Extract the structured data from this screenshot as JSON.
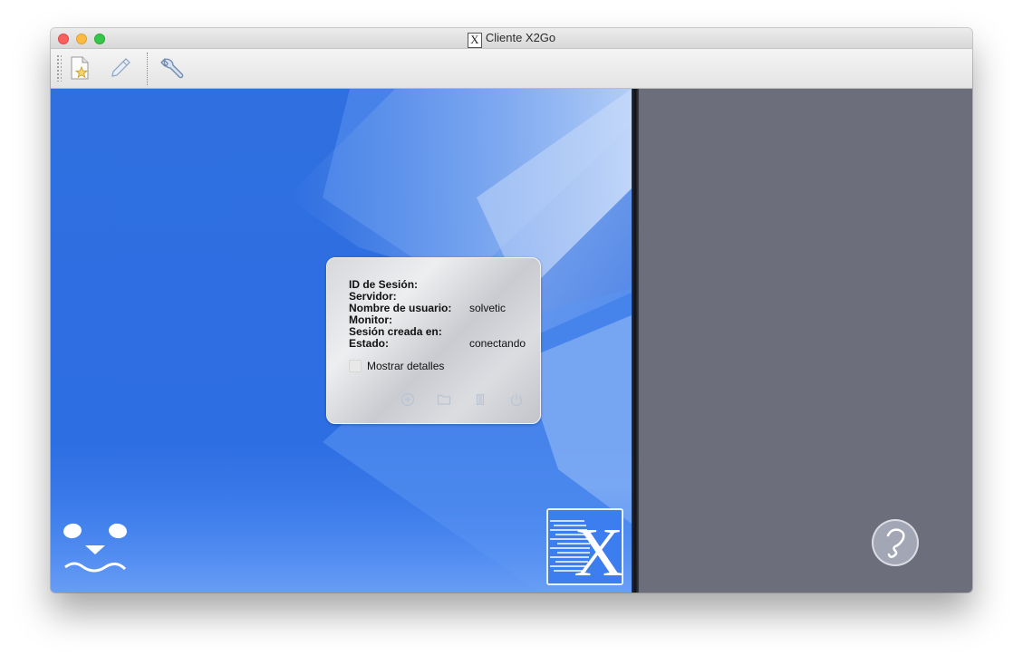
{
  "window": {
    "title": "Cliente X2Go",
    "title_icon": "x2go-x-icon"
  },
  "toolbar": {
    "items": [
      {
        "name": "new-session",
        "icon": "new-document-star-icon"
      },
      {
        "name": "edit-session",
        "icon": "pencil-icon"
      },
      {
        "name": "preferences",
        "icon": "wrench-icon"
      }
    ]
  },
  "session_panel": {
    "fields": [
      {
        "label": "ID de Sesión:",
        "value": ""
      },
      {
        "label": "Servidor:",
        "value": ""
      },
      {
        "label": "Nombre de usuario:",
        "value": "solvetic"
      },
      {
        "label": "Monitor:",
        "value": ""
      },
      {
        "label": "Sesión creada en:",
        "value": ""
      },
      {
        "label": "Estado:",
        "value": "conectando"
      }
    ],
    "show_details": {
      "label": "Mostrar detalles",
      "checked": false
    },
    "actions": [
      {
        "name": "share",
        "icon": "circle-plus-icon"
      },
      {
        "name": "folder",
        "icon": "folder-icon"
      },
      {
        "name": "suspend",
        "icon": "pause-icon"
      },
      {
        "name": "terminate",
        "icon": "power-icon"
      }
    ]
  },
  "colors": {
    "desktop_blue": "#2d6ee3",
    "right_pane": "#6c6e7c"
  }
}
